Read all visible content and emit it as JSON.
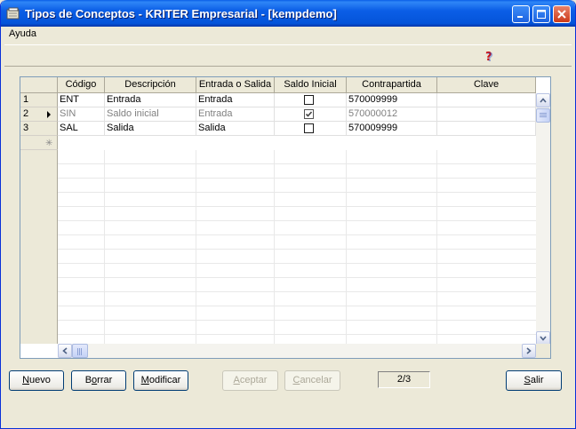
{
  "window": {
    "title": "Tipos de Conceptos - KRITER Empresarial - [kempdemo]"
  },
  "menu": {
    "items": [
      {
        "label": "Ayuda"
      }
    ]
  },
  "icons": {
    "app": "folder-icon",
    "help": "help-question-icon",
    "minimize": "minimize-icon",
    "maximize": "maximize-icon",
    "close": "close-icon"
  },
  "grid": {
    "columns": [
      "Código",
      "Descripción",
      "Entrada o Salida",
      "Saldo Inicial",
      "Contrapartida",
      "Clave"
    ],
    "rows": [
      {
        "num": "1",
        "codigo": "ENT",
        "descripcion": "Entrada",
        "tipo": "Entrada",
        "saldo_inicial": false,
        "contrapartida": "570009999",
        "clave": "",
        "current": false,
        "disabled": false
      },
      {
        "num": "2",
        "codigo": "SIN",
        "descripcion": "Saldo inicial",
        "tipo": "Entrada",
        "saldo_inicial": true,
        "contrapartida": "570000012",
        "clave": "",
        "current": true,
        "disabled": true
      },
      {
        "num": "3",
        "codigo": "SAL",
        "descripcion": "Salida",
        "tipo": "Salida",
        "saldo_inicial": false,
        "contrapartida": "570009999",
        "clave": "",
        "current": false,
        "disabled": false
      }
    ]
  },
  "buttons": {
    "nuevo": {
      "pre": "",
      "key": "N",
      "post": "uevo"
    },
    "borrar": {
      "pre": "B",
      "key": "o",
      "post": "rrar"
    },
    "modificar": {
      "pre": "",
      "key": "M",
      "post": "odificar"
    },
    "aceptar": {
      "pre": "",
      "key": "A",
      "post": "ceptar"
    },
    "cancelar": {
      "pre": "",
      "key": "C",
      "post": "ancelar"
    },
    "salir": {
      "pre": "",
      "key": "S",
      "post": "alir"
    }
  },
  "record_counter": "2/3"
}
